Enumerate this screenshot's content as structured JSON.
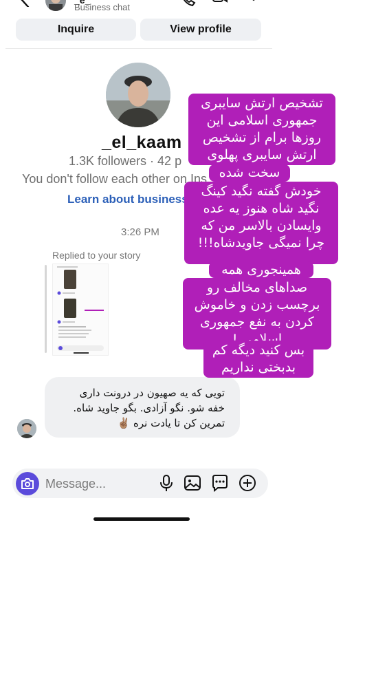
{
  "header": {
    "name": "_e_",
    "subtitle": "Business chat"
  },
  "actions": {
    "inquire_label": "Inquire",
    "view_profile_label": "View profile"
  },
  "profile": {
    "username": "_el_kaam",
    "stats": "1.3K followers · 42 p",
    "follow_status": "You don't follow each other on Ins",
    "link_text": "Learn about business"
  },
  "thread": {
    "timestamp": "3:26 PM",
    "replied_label": "Replied to your story",
    "message_lines": [
      "تویی که یه صهیون در درونت داری",
      "خفه شو. نگو آزادی. بگو جاوید شاه.",
      "تمرین کن تا یادت نره ✌🏽"
    ]
  },
  "overlay": {
    "color": "#b01fb8",
    "lines": [
      "تشخیص ارتش سایبری",
      "جمهوری اسلامی این",
      "روزها برام از تشخیص",
      "ارتش سایبری پهلوی",
      "سخت شده",
      "خودش گفته نگید کینگ",
      "نگید شاه هنوز یه عده",
      "وایسادن بالاسر من که",
      "چرا نمیگی جاویدشاه!!!",
      "همینجوری همه",
      "صداهای مخالف رو",
      "برچسب زدن و خاموش",
      "کردن به نفع جمهوری",
      "اسلامی !",
      "بس کنید دیگه کم",
      "بدبختی نداریم"
    ]
  },
  "composer": {
    "placeholder": "Message...",
    "accent": "#5b4bdb"
  }
}
